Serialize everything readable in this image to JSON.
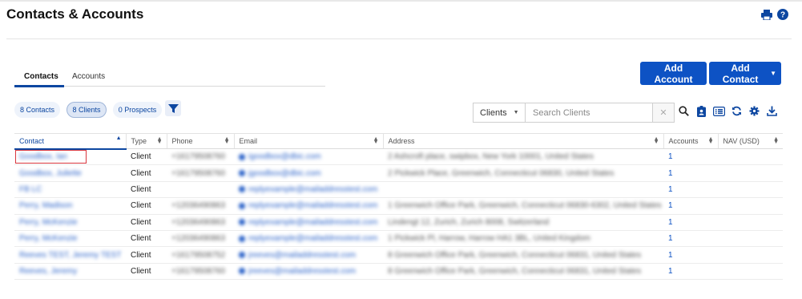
{
  "page": {
    "title": "Contacts & Accounts"
  },
  "header_icons": [
    "print-icon",
    "help-icon"
  ],
  "tabs": [
    {
      "label": "Contacts",
      "active": true
    },
    {
      "label": "Accounts",
      "active": false
    }
  ],
  "buttons": {
    "add_account": "Add Account",
    "add_contact": "Add Contact"
  },
  "filters": {
    "contacts": "8 Contacts",
    "clients": "8 Clients",
    "prospects": "0 Prospects"
  },
  "search": {
    "scope": "Clients",
    "placeholder": "Search Clients",
    "clear": "✕"
  },
  "table": {
    "columns": {
      "contact": "Contact",
      "type": "Type",
      "phone": "Phone",
      "email": "Email",
      "address": "Address",
      "accounts": "Accounts",
      "nav": "NAV (USD)"
    },
    "rows": [
      {
        "contact": "Goodbox, Ian",
        "type": "Client",
        "phone": "+16179508760",
        "email": "igoodbox@dbic.com",
        "address": "2 Ashcroft place, swipbox, New York 10001, United States",
        "accounts": "1",
        "nav": ""
      },
      {
        "contact": "Goodbox, Juliette",
        "type": "Client",
        "phone": "+16179508760",
        "email": "jgoodbox@dbic.com",
        "address": "2 Pickwick Place, Greenwich, Connecticut 06830, United States",
        "accounts": "1",
        "nav": ""
      },
      {
        "contact": "FB LC",
        "type": "Client",
        "phone": "",
        "email": "replyexample@mailaddresstest.com",
        "address": "",
        "accounts": "1",
        "nav": ""
      },
      {
        "contact": "Perry, Madison",
        "type": "Client",
        "phone": "+12036490863",
        "email": "replyexample@mailaddresstest.com",
        "address": "1 Greenwich Office Park, Greenwich, Connecticut 06830-6302, United States",
        "accounts": "1",
        "nav": ""
      },
      {
        "contact": "Perry, McKenzie",
        "type": "Client",
        "phone": "+12036490863",
        "email": "replyexample@mailaddresstest.com",
        "address": "Lindengt 12, Zurich, Zurich 8008, Switzerland",
        "accounts": "1",
        "nav": ""
      },
      {
        "contact": "Perry, McKenzie",
        "type": "Client",
        "phone": "+12036490863",
        "email": "replyexample@mailaddresstest.com",
        "address": "1 Pickwick Pl, Harrow, Harrow HA1 3BL, United Kingdom",
        "accounts": "1",
        "nav": ""
      },
      {
        "contact": "Reeves TEST, Jeremy TEST",
        "type": "Client",
        "phone": "+16179508752",
        "email": "jreeves@mailaddresstest.com",
        "address": "8 Greenwich Office Park, Greenwich, Connecticut 06831, United States",
        "accounts": "1",
        "nav": ""
      },
      {
        "contact": "Reeves, Jeremy",
        "type": "Client",
        "phone": "+16179508760",
        "email": "jreeves@mailaddresstest.com",
        "address": "8 Greenwich Office Park, Greenwich, Connecticut 06831, United States",
        "accounts": "1",
        "nav": ""
      }
    ]
  },
  "colors": {
    "primary": "#0d52c4",
    "link": "#2a62c9",
    "highlight": "#d9363e"
  }
}
